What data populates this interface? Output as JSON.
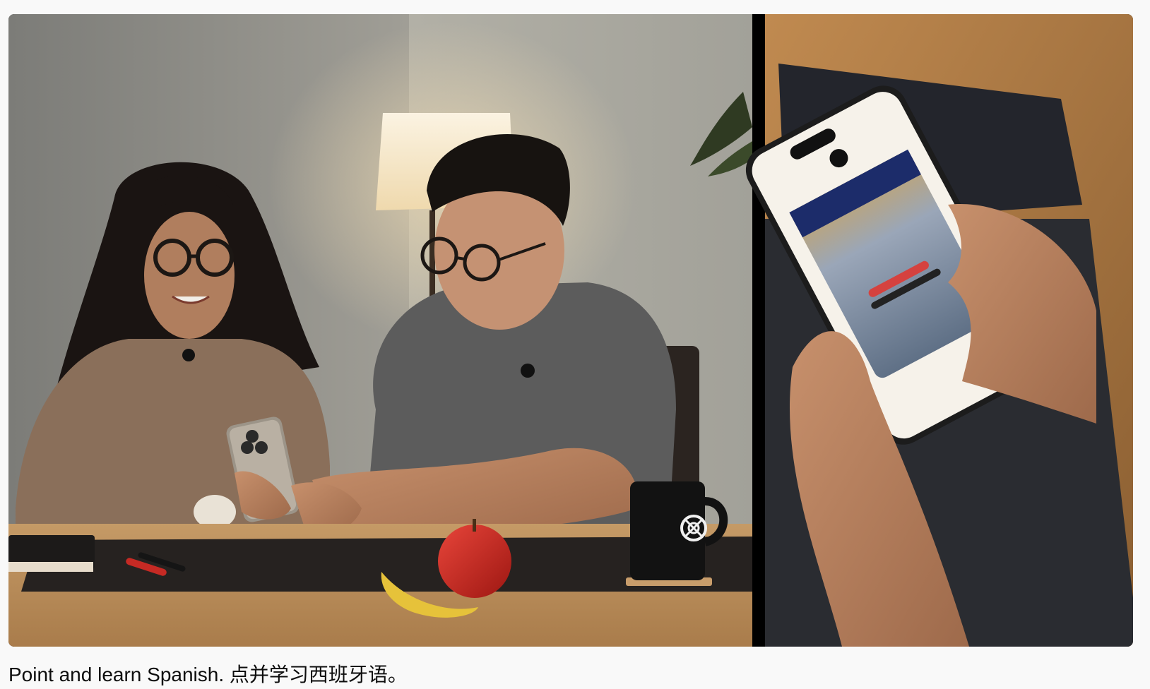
{
  "caption": "Point and learn Spanish. 点并学习西班牙语。",
  "media": {
    "panels": [
      {
        "name": "studio-scene",
        "description_visible": false
      },
      {
        "name": "phone-closeup",
        "description_visible": false
      }
    ]
  },
  "colors": {
    "page_background": "#f9f9f9",
    "caption_text": "#0d0d0d",
    "wall": "#8a8a84",
    "table": "#b98d5c",
    "mat": "#262220",
    "divider": "#000000"
  },
  "icons": [
    "openai-logo-icon"
  ]
}
